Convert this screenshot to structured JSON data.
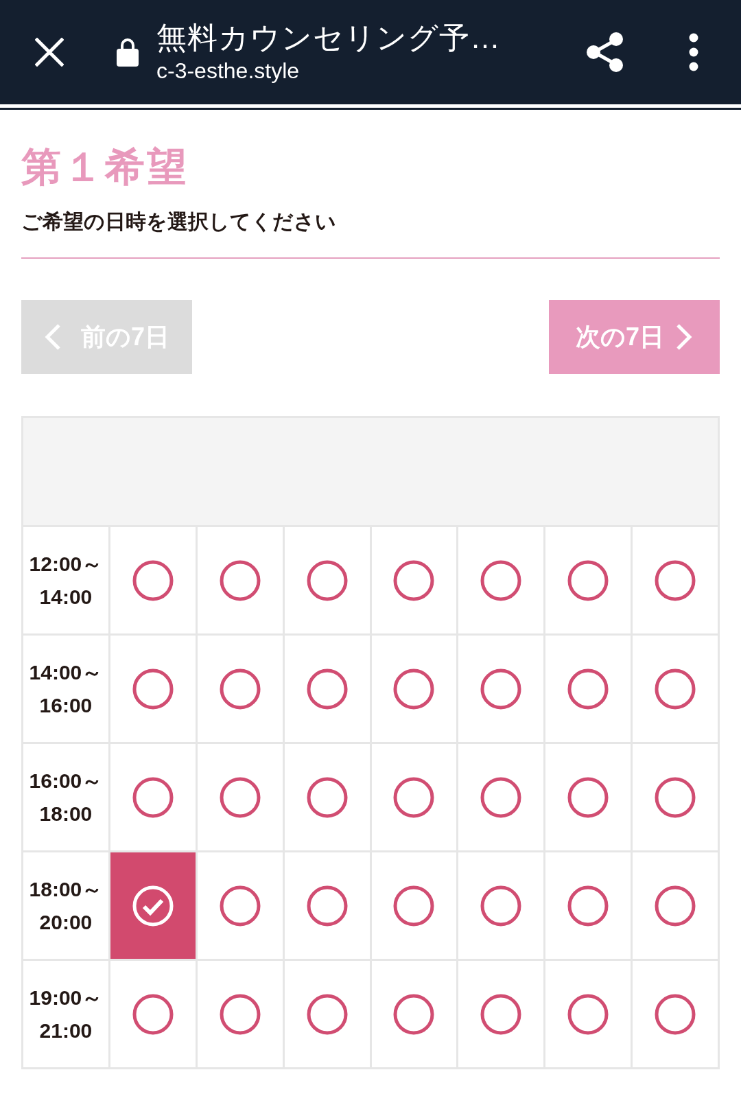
{
  "app_bar": {
    "title": "無料カウンセリング予…",
    "url": "c-3-esthe.style"
  },
  "heading": "第１希望",
  "instruction": "ご希望の日時を選択してください",
  "nav_buttons": [
    {
      "kind": "prev",
      "label": "前の7日",
      "disabled": true
    },
    {
      "kind": "next",
      "label": "次の7日",
      "disabled": false
    }
  ],
  "schedule": {
    "rows": [
      {
        "time_lines": [
          "12:00～",
          "14:00"
        ],
        "slots": [
          {
            "selected": false
          },
          {
            "selected": false
          },
          {
            "selected": false
          },
          {
            "selected": false
          },
          {
            "selected": false
          },
          {
            "selected": false
          },
          {
            "selected": false
          }
        ]
      },
      {
        "time_lines": [
          "14:00～",
          "16:00"
        ],
        "slots": [
          {
            "selected": false
          },
          {
            "selected": false
          },
          {
            "selected": false
          },
          {
            "selected": false
          },
          {
            "selected": false
          },
          {
            "selected": false
          },
          {
            "selected": false
          }
        ]
      },
      {
        "time_lines": [
          "16:00～",
          "18:00"
        ],
        "slots": [
          {
            "selected": false
          },
          {
            "selected": false
          },
          {
            "selected": false
          },
          {
            "selected": false
          },
          {
            "selected": false
          },
          {
            "selected": false
          },
          {
            "selected": false
          }
        ]
      },
      {
        "time_lines": [
          "18:00～",
          "20:00"
        ],
        "slots": [
          {
            "selected": true
          },
          {
            "selected": false
          },
          {
            "selected": false
          },
          {
            "selected": false
          },
          {
            "selected": false
          },
          {
            "selected": false
          },
          {
            "selected": false
          }
        ]
      },
      {
        "time_lines": [
          "19:00～",
          "21:00"
        ],
        "slots": [
          {
            "selected": false
          },
          {
            "selected": false
          },
          {
            "selected": false
          },
          {
            "selected": false
          },
          {
            "selected": false
          },
          {
            "selected": false
          },
          {
            "selected": false
          }
        ]
      }
    ]
  }
}
